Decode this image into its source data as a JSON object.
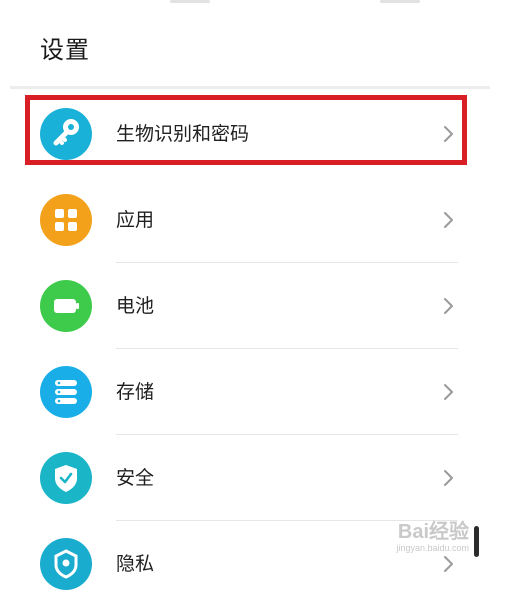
{
  "header": {
    "title": "设置"
  },
  "settings": {
    "items": [
      {
        "label": "生物识别和密码",
        "icon": "key-icon",
        "color": "#1ab1d8",
        "highlighted": true
      },
      {
        "label": "应用",
        "icon": "apps-grid-icon",
        "color": "#f3a11b"
      },
      {
        "label": "电池",
        "icon": "battery-icon",
        "color": "#3ecb4c"
      },
      {
        "label": "存储",
        "icon": "storage-icon",
        "color": "#1aaee8"
      },
      {
        "label": "安全",
        "icon": "shield-check-icon",
        "color": "#1ab5c7"
      },
      {
        "label": "隐私",
        "icon": "privacy-icon",
        "color": "#1aaccf"
      }
    ]
  },
  "highlight": {
    "color": "#d91f26"
  },
  "watermark": {
    "brand": "Bai经验",
    "site": "jingyan.baidu.com"
  }
}
